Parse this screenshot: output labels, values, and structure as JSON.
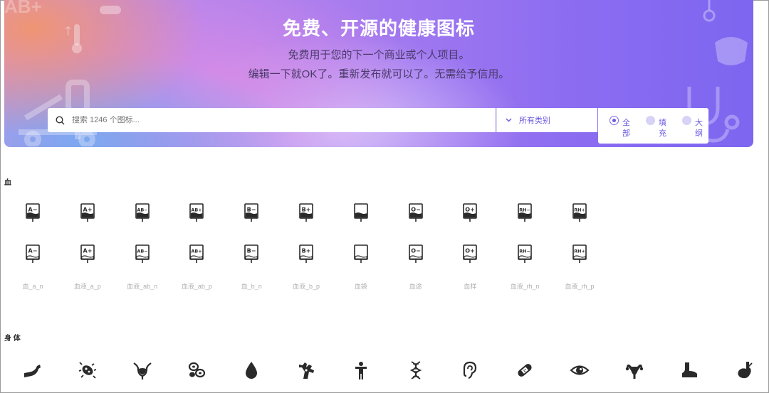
{
  "hero": {
    "title": "免费、开源的健康图标",
    "subtitle_line1": "免费用于您的下一个商业或个人项目。",
    "subtitle_line2": "编辑一下就OK了。重新发布就可以了。无需给予信用。",
    "deco_text": "AB+"
  },
  "search": {
    "placeholder": "搜索 1246 个图标...",
    "value": "",
    "category_label": "所有类别",
    "filter_options": [
      {
        "line1": "全",
        "line2": "部",
        "selected": true
      },
      {
        "line1": "填",
        "line2": "充",
        "selected": false
      },
      {
        "line1": "大",
        "line2": "纲",
        "selected": false
      }
    ]
  },
  "sections": {
    "blood": {
      "title": "血",
      "filled_icons": [
        "A−",
        "A+",
        "AB−",
        "AB+",
        "B−",
        "B+",
        "",
        "O−",
        "O+",
        "RH−",
        "RH+"
      ],
      "outline_icons": [
        "A−",
        "A+",
        "AB−",
        "AB+",
        "B−",
        "B+",
        "",
        "O−",
        "O+",
        "RH−",
        "RH+"
      ],
      "captions": [
        "血_a_n",
        "血液_a_p",
        "血液_ab_n",
        "血液_ab_p",
        "血_b_n",
        "血液_b_p",
        "血袋",
        "血途",
        "血样",
        "血液_rh_n",
        "血液_rh_p"
      ]
    },
    "body": {
      "title": "身 体",
      "icons": [
        "arm-icon",
        "bacteria-icon",
        "bladder-icon",
        "blood-cells-icon",
        "blood-drop-icon",
        "bone-marrow-icon",
        "body-icon",
        "dna-icon",
        "ear-icon",
        "bandage-icon",
        "eye-icon",
        "uterus-icon",
        "foot-icon",
        "gallbladder-icon"
      ]
    }
  },
  "colors": {
    "accent": "#6a5ae0",
    "icon_dark": "#2a2a2a",
    "caption": "#b0b0b0"
  }
}
